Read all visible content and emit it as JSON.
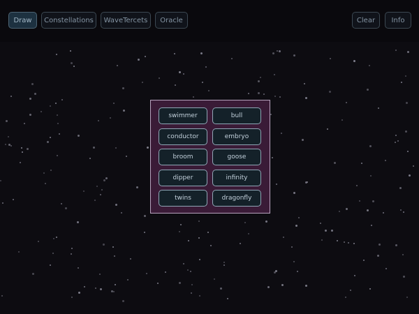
{
  "toolbar": {
    "draw_label": "Draw",
    "constellations_label": "Constellations",
    "wavetercets_label": "WaveTercets",
    "oracle_label": "Oracle",
    "clear_label": "Clear",
    "info_label": "Info"
  },
  "choices": [
    "swimmer",
    "bull",
    "conductor",
    "embryo",
    "broom",
    "goose",
    "dipper",
    "infinity",
    "twins",
    "dragonfly"
  ],
  "colors": {
    "background": "#0d0c11",
    "panel": "#3a1b37",
    "button_border": "#8fa7b6",
    "star": "#8a8a98"
  }
}
